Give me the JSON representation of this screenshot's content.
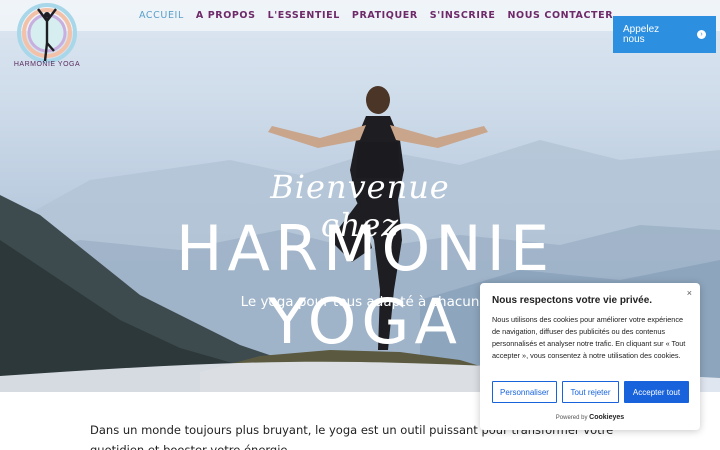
{
  "logo": {
    "text": "HARMONIE YOGA"
  },
  "nav": {
    "items": [
      {
        "label": "ACCUEIL",
        "active": true
      },
      {
        "label": "A PROPOS",
        "active": false
      },
      {
        "label": "L'ESSENTIEL",
        "active": false
      },
      {
        "label": "PRATIQUER",
        "active": false
      },
      {
        "label": "S'INSCRIRE",
        "active": false
      },
      {
        "label": "NOUS CONTACTER",
        "active": false
      }
    ]
  },
  "call_button": {
    "label": "Appelez nous",
    "icon": "arrow-right-icon"
  },
  "hero": {
    "script_text": "Bienvenue chez",
    "title": "HARMONIE YOGA",
    "subtitle": "Le yoga pour tous adapté à chacun"
  },
  "intro": {
    "text": "Dans un monde toujours plus bruyant, le yoga est un outil puissant pour transformer votre quotidien et booster votre énergie."
  },
  "cookie": {
    "title": "Nous respectons votre vie privée.",
    "body": "Nous utilisons des cookies pour améliorer votre expérience de navigation, diffuser des publicités ou des contenus personnalisés et analyser notre trafic. En cliquant sur « Tout accepter », vous consentez à notre utilisation des cookies.",
    "close": "×",
    "customize": "Personnaliser",
    "reject": "Tout rejeter",
    "accept": "Accepter tout",
    "powered_by": "Powered by",
    "brand": "Cookieyes"
  },
  "colors": {
    "nav_active": "#5aa0c8",
    "nav": "#6e2a68",
    "call_button": "#2c8fe0",
    "cookie_accent": "#1863dc"
  }
}
